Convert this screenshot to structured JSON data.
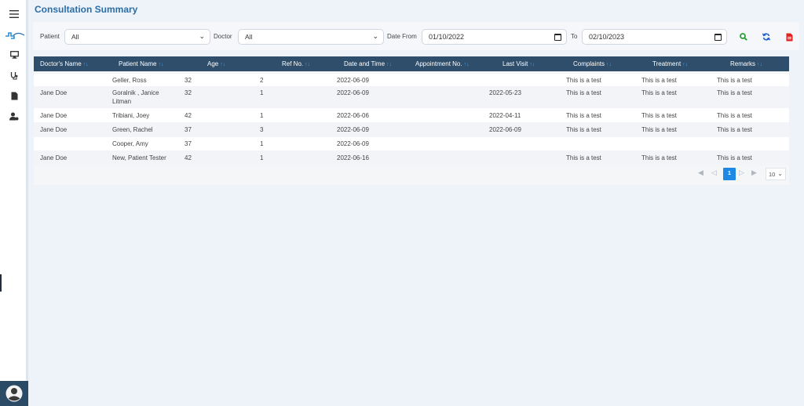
{
  "page": {
    "title": "Consultation Summary"
  },
  "sidebar": {
    "items": [
      {
        "icon": "menu-icon"
      },
      {
        "icon": "logo-icon"
      },
      {
        "icon": "monitor-icon"
      },
      {
        "icon": "stethoscope-icon"
      },
      {
        "icon": "document-icon"
      },
      {
        "icon": "user-settings-icon"
      }
    ],
    "avatar_icon": "avatar-icon"
  },
  "filters": {
    "patient_label": "Patient",
    "patient_value": "All",
    "doctor_label": "Doctor",
    "doctor_value": "All",
    "date_from_label": "Date From",
    "date_from_value": "01/10/2022",
    "to_label": "To",
    "date_to_value": "02/10/2023",
    "actions": [
      {
        "icon": "search-icon",
        "color": "#2e9e3a"
      },
      {
        "icon": "refresh-icon",
        "color": "#1e5bd6"
      },
      {
        "icon": "pdf-icon",
        "color": "#e02424"
      }
    ]
  },
  "table": {
    "columns": [
      "Doctor's Name",
      "Patient Name",
      "Age",
      "Ref No.",
      "Date and Time",
      "Appointment No.",
      "Last Visit",
      "Complaints",
      "Treatment",
      "Remarks"
    ],
    "rows": [
      [
        "",
        "Geller, Ross",
        "32",
        "2",
        "2022-06-09",
        "",
        "",
        "This is a test",
        "This is a test",
        "This is a test"
      ],
      [
        "Jane Doe",
        "Goralnik , Janice Litman",
        "32",
        "1",
        "2022-06-09",
        "",
        "2022-05-23",
        "This is a test",
        "This is a test",
        "This is a test"
      ],
      [
        "Jane Doe",
        "Tribiani, Joey",
        "42",
        "1",
        "2022-06-06",
        "",
        "2022-04-11",
        "This is a test",
        "This is a test",
        "This is a test"
      ],
      [
        "Jane Doe",
        "Green, Rachel",
        "37",
        "3",
        "2022-06-09",
        "",
        "2022-06-09",
        "This is a test",
        "This is a test",
        "This is a test"
      ],
      [
        "",
        "Cooper, Amy",
        "37",
        "1",
        "2022-06-09",
        "",
        "",
        "",
        "",
        ""
      ],
      [
        "Jane Doe",
        "New, Patient Tester",
        "42",
        "1",
        "2022-06-16",
        "",
        "",
        "This is a test",
        "This is a test",
        "This is a test"
      ]
    ]
  },
  "pagination": {
    "current_page": "1",
    "page_size": "10"
  },
  "colors": {
    "header_bg": "#2f4e6b",
    "accent": "#1e88e5",
    "title": "#2a6fa8"
  }
}
